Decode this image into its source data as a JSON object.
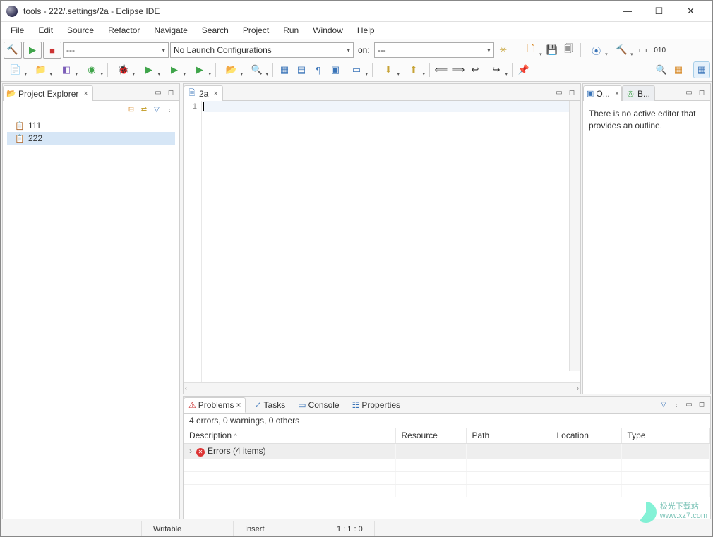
{
  "window": {
    "title": "tools - 222/.settings/2a - Eclipse IDE"
  },
  "menu": [
    "File",
    "Edit",
    "Source",
    "Refactor",
    "Navigate",
    "Search",
    "Project",
    "Run",
    "Window",
    "Help"
  ],
  "toolbar1": {
    "combo_project": "---",
    "combo_launch": "No Launch Configurations",
    "label_on": "on:",
    "combo_target": "---"
  },
  "project_explorer": {
    "title": "Project Explorer",
    "items": [
      {
        "label": "111",
        "selected": false
      },
      {
        "label": "222",
        "selected": true
      }
    ]
  },
  "editor": {
    "tab_label": "2a",
    "line_number": "1",
    "content": ""
  },
  "outline": {
    "tab_o": "O...",
    "tab_b": "B...",
    "message": "There is no active editor that provides an outline."
  },
  "bottom": {
    "tabs": [
      {
        "label": "Problems",
        "active": true
      },
      {
        "label": "Tasks",
        "active": false
      },
      {
        "label": "Console",
        "active": false
      },
      {
        "label": "Properties",
        "active": false
      }
    ],
    "summary": "4 errors, 0 warnings, 0 others",
    "columns": [
      "Description",
      "Resource",
      "Path",
      "Location",
      "Type"
    ],
    "rows": [
      {
        "description": "Errors (4 items)",
        "resource": "",
        "path": "",
        "location": "",
        "type": "",
        "expandable": true
      }
    ]
  },
  "status": {
    "writable": "Writable",
    "insert": "Insert",
    "pos": "1 : 1 : 0"
  },
  "watermark": {
    "text1": "极光下载站",
    "text2": "www.xz7.com"
  }
}
